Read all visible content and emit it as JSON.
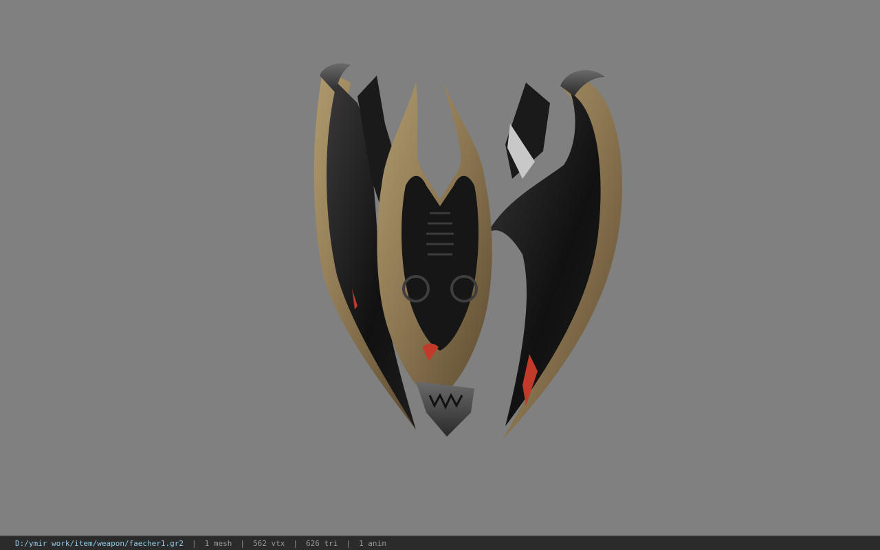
{
  "viewport": {
    "background": "#808080",
    "model_icon": "winged-shield-model"
  },
  "status_bar": {
    "file_path": "D:/ymir work/item/weapon/faecher1.gr2",
    "separator": "|",
    "mesh_count": "1 mesh",
    "vertex_count": "562 vtx",
    "triangle_count": "626 tri",
    "anim_count": "1 anim",
    "path_color": "#8ec9e6",
    "bg_color": "#2b2b2b"
  }
}
